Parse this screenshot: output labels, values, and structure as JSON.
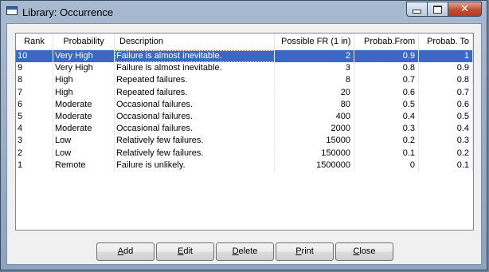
{
  "window": {
    "title": "Library: Occurrence"
  },
  "columns": [
    "Rank",
    "Probability",
    "Description",
    "Possible FR (1 in)",
    "Probab.From",
    "Probab. To"
  ],
  "rows": [
    [
      "10",
      "Very High",
      "Failure is almost inevitable.",
      "2",
      "0.9",
      "1"
    ],
    [
      "9",
      "Very High",
      "Failure is almost inevitable.",
      "3",
      "0.8",
      "0.9"
    ],
    [
      "8",
      "High",
      "Repeated failures.",
      "8",
      "0.7",
      "0.8"
    ],
    [
      "7",
      "High",
      "Repeated failures.",
      "20",
      "0.6",
      "0.7"
    ],
    [
      "6",
      "Moderate",
      "Occasional failures.",
      "80",
      "0.5",
      "0.6"
    ],
    [
      "5",
      "Moderate",
      "Occasional failures.",
      "400",
      "0.4",
      "0.5"
    ],
    [
      "4",
      "Moderate",
      "Occasional failures.",
      "2000",
      "0.3",
      "0.4"
    ],
    [
      "3",
      "Low",
      "Relatively few failures.",
      "15000",
      "0.2",
      "0.3"
    ],
    [
      "2",
      "Low",
      "Relatively few failures.",
      "150000",
      "0.1",
      "0.2"
    ],
    [
      "1",
      "Remote",
      "Failure is unlikely.",
      "1500000",
      "0",
      "0.1"
    ]
  ],
  "selected_row": 0,
  "buttons": [
    {
      "first": "A",
      "rest": "dd"
    },
    {
      "first": "E",
      "rest": "dit"
    },
    {
      "first": "D",
      "rest": "elete"
    },
    {
      "first": "P",
      "rest": "rint"
    },
    {
      "first": "C",
      "rest": "lose"
    }
  ],
  "colors": {
    "selection": "#3a68c4",
    "close_button": "#c44a31"
  }
}
